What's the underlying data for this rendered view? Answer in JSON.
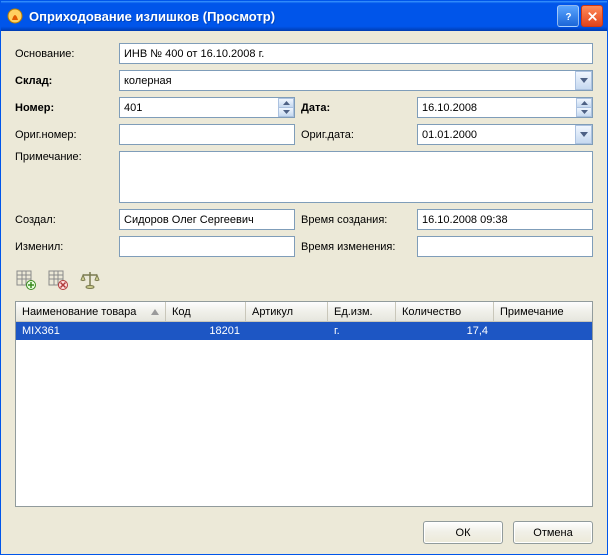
{
  "window": {
    "title": "Оприходование излишков (Просмотр)"
  },
  "labels": {
    "basis": "Основание:",
    "warehouse": "Склад:",
    "number": "Номер:",
    "date": "Дата:",
    "orig_number": "Ориг.номер:",
    "orig_date": "Ориг.дата:",
    "note": "Примечание:",
    "created_by": "Создал:",
    "created_at": "Время создания:",
    "modified_by": "Изменил:",
    "modified_at": "Время изменения:"
  },
  "fields": {
    "basis": "ИНВ № 400 от 16.10.2008 г.",
    "warehouse": "колерная",
    "number": "401",
    "date": "16.10.2008",
    "orig_number": "",
    "orig_date": "01.01.2000",
    "note": "",
    "created_by": "Сидоров Олег Сергеевич",
    "created_at": "16.10.2008 09:38",
    "modified_by": "",
    "modified_at": ""
  },
  "grid": {
    "columns": {
      "name": "Наименование товара",
      "code": "Код",
      "article": "Артикул",
      "unit": "Ед.изм.",
      "qty": "Количество",
      "note": "Примечание"
    },
    "row": {
      "name": "MIX361",
      "code": "18201",
      "article": "",
      "unit": "г.",
      "qty": "17,4",
      "note": ""
    }
  },
  "buttons": {
    "ok": "ОК",
    "cancel": "Отмена"
  },
  "icons": {
    "add_row": "add-grid-row",
    "delete_row": "delete-grid-row",
    "scales": "scales"
  }
}
